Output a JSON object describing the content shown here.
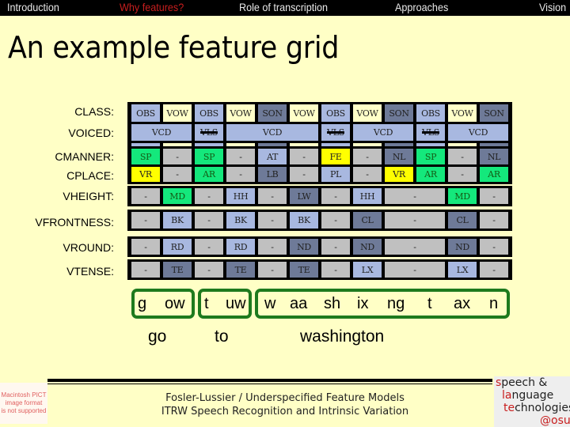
{
  "nav": {
    "items": [
      {
        "label": "Introduction",
        "active": false
      },
      {
        "label": "Why features?",
        "active": true
      },
      {
        "label": "Role of transcription",
        "active": false
      },
      {
        "label": "Approaches",
        "active": false
      },
      {
        "label": "Vision",
        "active": false
      }
    ]
  },
  "slide": {
    "title": "An example feature grid"
  },
  "grid": {
    "row_labels": [
      "CLASS:",
      "VOICED:",
      "CMANNER:",
      "CPLACE:",
      "VHEIGHT:",
      "VFRONTNESS:",
      "VROUND:",
      "VTENSE:"
    ],
    "colors": {
      "blue": "#a8b8e0",
      "cream": "#ffffc8",
      "slate": "#6e7a98",
      "green": "#14e87c",
      "yellow": "#ffff00",
      "gray": "#c0c0c0"
    },
    "rows": {
      "class": [
        {
          "text": "OBS",
          "color": "blue",
          "span": 1
        },
        {
          "text": "VOW",
          "color": "cream",
          "span": 1
        },
        {
          "text": "OBS",
          "color": "blue",
          "span": 1
        },
        {
          "text": "VOW",
          "color": "cream",
          "span": 1
        },
        {
          "text": "SON",
          "color": "slate",
          "span": 1
        },
        {
          "text": "VOW",
          "color": "cream",
          "span": 1
        },
        {
          "text": "OBS",
          "color": "blue",
          "span": 1
        },
        {
          "text": "VOW",
          "color": "cream",
          "span": 1
        },
        {
          "text": "SON",
          "color": "slate",
          "span": 1
        },
        {
          "text": "OBS",
          "color": "blue",
          "span": 1
        },
        {
          "text": "VOW",
          "color": "cream",
          "span": 1
        },
        {
          "text": "SON",
          "color": "slate",
          "span": 1
        }
      ],
      "voiced": [
        {
          "text": "VCD",
          "color": "blue",
          "span": 2,
          "struck": false
        },
        {
          "text": "VLS",
          "color": "blue",
          "span": 1,
          "struck": true
        },
        {
          "text": "VCD",
          "color": "blue",
          "span": 3,
          "struck": false
        },
        {
          "text": "VLS",
          "color": "blue",
          "span": 1,
          "struck": true
        },
        {
          "text": "VCD",
          "color": "blue",
          "span": 2,
          "struck": false
        },
        {
          "text": "VLS",
          "color": "blue",
          "span": 1,
          "struck": true
        },
        {
          "text": "VCD",
          "color": "blue",
          "span": 2,
          "struck": false
        }
      ],
      "cmanner": [
        {
          "text": "SP",
          "color": "green",
          "span": 1
        },
        {
          "text": "-",
          "color": "gray",
          "span": 1
        },
        {
          "text": "SP",
          "color": "green",
          "span": 1
        },
        {
          "text": "-",
          "color": "gray",
          "span": 1
        },
        {
          "text": "AT",
          "color": "blue",
          "span": 1
        },
        {
          "text": "-",
          "color": "gray",
          "span": 1
        },
        {
          "text": "FE",
          "color": "yellow",
          "span": 1
        },
        {
          "text": "-",
          "color": "gray",
          "span": 1
        },
        {
          "text": "NL",
          "color": "slate",
          "span": 1
        },
        {
          "text": "SP",
          "color": "green",
          "span": 1
        },
        {
          "text": "-",
          "color": "gray",
          "span": 1
        },
        {
          "text": "NL",
          "color": "slate",
          "span": 1
        }
      ],
      "cplace": [
        {
          "text": "VR",
          "color": "yellow",
          "span": 1
        },
        {
          "text": "-",
          "color": "gray",
          "span": 1
        },
        {
          "text": "AR",
          "color": "green",
          "span": 1
        },
        {
          "text": "-",
          "color": "gray",
          "span": 1
        },
        {
          "text": "LB",
          "color": "slate",
          "span": 1
        },
        {
          "text": "-",
          "color": "gray",
          "span": 1
        },
        {
          "text": "PL",
          "color": "blue",
          "span": 1
        },
        {
          "text": "-",
          "color": "gray",
          "span": 1
        },
        {
          "text": "VR",
          "color": "yellow",
          "span": 1
        },
        {
          "text": "AR",
          "color": "green",
          "span": 1
        },
        {
          "text": "-",
          "color": "gray",
          "span": 1
        },
        {
          "text": "AR",
          "color": "green",
          "span": 1
        }
      ],
      "vheight": [
        {
          "text": "-",
          "color": "gray",
          "span": 1
        },
        {
          "text": "MD",
          "color": "green",
          "span": 1
        },
        {
          "text": "-",
          "color": "gray",
          "span": 1
        },
        {
          "text": "HH",
          "color": "blue",
          "span": 1
        },
        {
          "text": "-",
          "color": "gray",
          "span": 1
        },
        {
          "text": "LW",
          "color": "slate",
          "span": 1
        },
        {
          "text": "-",
          "color": "gray",
          "span": 1
        },
        {
          "text": "HH",
          "color": "blue",
          "span": 1
        },
        {
          "text": "-",
          "color": "gray",
          "span": 2
        },
        {
          "text": "MD",
          "color": "green",
          "span": 1
        },
        {
          "text": "-",
          "color": "gray",
          "span": 1
        }
      ],
      "vfrontness": [
        {
          "text": "-",
          "color": "gray",
          "span": 1
        },
        {
          "text": "BK",
          "color": "blue",
          "span": 1
        },
        {
          "text": "-",
          "color": "gray",
          "span": 1
        },
        {
          "text": "BK",
          "color": "blue",
          "span": 1
        },
        {
          "text": "-",
          "color": "gray",
          "span": 1
        },
        {
          "text": "BK",
          "color": "blue",
          "span": 1
        },
        {
          "text": "-",
          "color": "gray",
          "span": 1
        },
        {
          "text": "CL",
          "color": "slate",
          "span": 1
        },
        {
          "text": "-",
          "color": "gray",
          "span": 2
        },
        {
          "text": "CL",
          "color": "slate",
          "span": 1
        },
        {
          "text": "-",
          "color": "gray",
          "span": 1
        }
      ],
      "vround": [
        {
          "text": "-",
          "color": "gray",
          "span": 1
        },
        {
          "text": "RD",
          "color": "blue",
          "span": 1
        },
        {
          "text": "-",
          "color": "gray",
          "span": 1
        },
        {
          "text": "RD",
          "color": "blue",
          "span": 1
        },
        {
          "text": "-",
          "color": "gray",
          "span": 1
        },
        {
          "text": "ND",
          "color": "slate",
          "span": 1
        },
        {
          "text": "-",
          "color": "gray",
          "span": 1
        },
        {
          "text": "ND",
          "color": "slate",
          "span": 1
        },
        {
          "text": "-",
          "color": "gray",
          "span": 2
        },
        {
          "text": "ND",
          "color": "slate",
          "span": 1
        },
        {
          "text": "-",
          "color": "gray",
          "span": 1
        }
      ],
      "vtense": [
        {
          "text": "-",
          "color": "gray",
          "span": 1
        },
        {
          "text": "TE",
          "color": "slate",
          "span": 1
        },
        {
          "text": "-",
          "color": "gray",
          "span": 1
        },
        {
          "text": "TE",
          "color": "slate",
          "span": 1
        },
        {
          "text": "-",
          "color": "gray",
          "span": 1
        },
        {
          "text": "TE",
          "color": "slate",
          "span": 1
        },
        {
          "text": "-",
          "color": "gray",
          "span": 1
        },
        {
          "text": "LX",
          "color": "blue",
          "span": 1
        },
        {
          "text": "-",
          "color": "gray",
          "span": 2
        },
        {
          "text": "LX",
          "color": "blue",
          "span": 1
        },
        {
          "text": "-",
          "color": "gray",
          "span": 1
        }
      ]
    },
    "class_strip_colors": [
      "blue",
      "cream",
      "blue",
      "cream",
      "slate",
      "cream",
      "blue",
      "cream",
      "slate",
      "blue",
      "cream",
      "slate"
    ]
  },
  "transcription": {
    "phones": [
      "g",
      "ow",
      "t",
      "uw",
      "w",
      "aa",
      "sh",
      "ix",
      "ng",
      "t",
      "ax",
      "n"
    ],
    "words": [
      "go",
      "to",
      "washington"
    ],
    "box_color": "#1e7a1e"
  },
  "footer": {
    "line1": "Fosler-Lussier / Underspecified Feature Models",
    "line2": "ITRW Speech Recognition and Intrinsic Variation"
  },
  "pict_placeholder": {
    "lines": [
      "Macintosh PICT",
      "image format",
      "is not supported"
    ]
  },
  "logo": {
    "lines": [
      {
        "first": "s",
        "rest": "peech &"
      },
      {
        "first": "la",
        "rest": "nguage"
      },
      {
        "first": "te",
        "rest": "chnologies"
      },
      {
        "first": "@osu",
        "rest": ""
      }
    ]
  }
}
